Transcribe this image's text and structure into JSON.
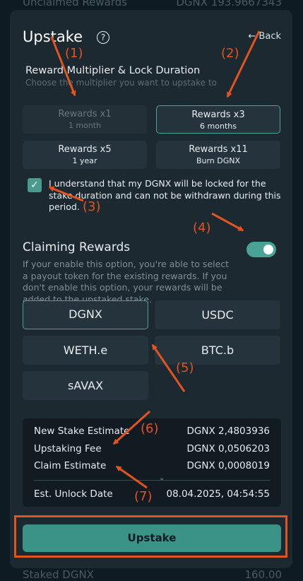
{
  "background": {
    "top_left": "Unclaimed Rewards",
    "top_right": "DGNX 193.9667343",
    "bottom_left": "Staked DGNX",
    "bottom_right": "160.00"
  },
  "header": {
    "title": "Upstake",
    "help_glyph": "?",
    "back_label": "← Back"
  },
  "multiplier": {
    "title": "Reward Multiplier & Lock Duration",
    "subtitle": "Choose the multiplier you want to upstake to",
    "options": [
      {
        "label": "Rewards x1",
        "duration": "1 month",
        "state": "disabled"
      },
      {
        "label": "Rewards x3",
        "duration": "6 months",
        "state": "selected"
      },
      {
        "label": "Rewards x5",
        "duration": "1 year",
        "state": "normal"
      },
      {
        "label": "Rewards x11",
        "duration": "Burn DGNX",
        "state": "normal"
      }
    ]
  },
  "consent": {
    "checked": true,
    "check_glyph": "✓",
    "text": "I understand that my DGNX will be locked for the stake duration and can not be withdrawn during this period."
  },
  "claiming": {
    "title": "Claiming Rewards",
    "enabled": true,
    "description": "If your enable this option, you're able to select a payout token for the existing rewards. If you don't enable this option, your rewards will be added to the upstaked stake.",
    "tokens": [
      "DGNX",
      "USDC",
      "WETH.e",
      "BTC.b",
      "sAVAX"
    ],
    "selected_token": "DGNX"
  },
  "summary": {
    "rows": [
      {
        "label": "New Stake Estimate",
        "value": "DGNX 2,4803936"
      },
      {
        "label": "Upstaking Fee",
        "value": "DGNX 0,0506203"
      },
      {
        "label": "Claim Estimate",
        "value": "DGNX 0,0008019"
      }
    ],
    "expand_glyph": "⌄",
    "unlock_label": "Est. Unlock Date",
    "unlock_value": "08.04.2025, 04:54:55"
  },
  "cta": {
    "label": "Upstake"
  },
  "annotations": {
    "color": "#e2541d",
    "labels": [
      "(1)",
      "(2)",
      "(3)",
      "(4)",
      "(5)",
      "(6)",
      "(7)"
    ]
  }
}
